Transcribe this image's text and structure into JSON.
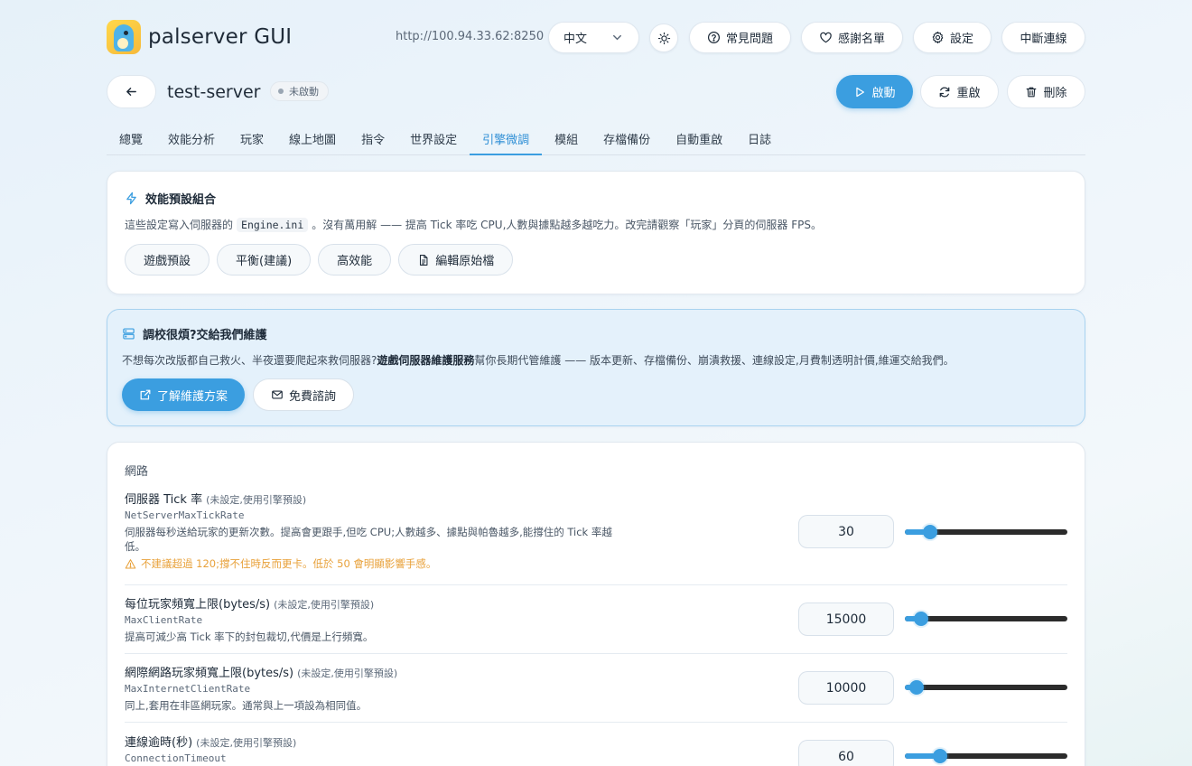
{
  "header": {
    "brand": "palserver GUI",
    "url": "http://100.94.33.62:8250",
    "language": "中文",
    "faq": "常見問題",
    "thanks": "感謝名單",
    "settings": "設定",
    "disconnect": "中斷連線"
  },
  "server": {
    "name": "test-server",
    "status": "未啟動",
    "start": "啟動",
    "restart": "重啟",
    "delete": "刪除"
  },
  "tabs": [
    "總覽",
    "效能分析",
    "玩家",
    "線上地圖",
    "指令",
    "世界設定",
    "引擎微調",
    "模組",
    "存檔備份",
    "自動重啟",
    "日誌"
  ],
  "active_tab": "引擎微調",
  "preset": {
    "title": "效能預設組合",
    "desc_before": "這些設定寫入伺服器的",
    "desc_code": "Engine.ini",
    "desc_after": "。沒有萬用解 —— 提高 Tick 率吃 CPU,人數與據點越多越吃力。改完請觀察「玩家」分頁的伺服器 FPS。",
    "buttons": [
      "遊戲預設",
      "平衡(建議)",
      "高效能"
    ],
    "edit_raw": "編輯原始檔"
  },
  "promo": {
    "title": "調校很煩?交給我們維護",
    "desc_before": "不想每次改版都自己救火、半夜還要爬起來救伺服器?",
    "desc_bold": "遊戲伺服器維護服務",
    "desc_after": "幫你長期代管維護 —— 版本更新、存檔備份、崩潰救援、連線設定,月費制透明計價,維運交給我們。",
    "primary": "了解維護方案",
    "secondary": "免費諮詢"
  },
  "network": {
    "section": "網路",
    "rows": [
      {
        "title": "伺服器 Tick 率",
        "hint": "(未設定,使用引擎預設)",
        "key": "NetServerMaxTickRate",
        "desc": "伺服器每秒送給玩家的更新次數。提高會更跟手,但吃 CPU;人數越多、據點與帕魯越多,能撐住的 Tick 率越低。",
        "warn": "不建議超過 120;撐不住時反而更卡。低於 50 會明顯影響手感。",
        "value": "30",
        "slider_fraction": 0.12
      },
      {
        "title": "每位玩家頻寬上限(bytes/s)",
        "hint": "(未設定,使用引擎預設)",
        "key": "MaxClientRate",
        "desc": "提高可減少高 Tick 率下的封包裁切,代價是上行頻寬。",
        "value": "15000",
        "slider_fraction": 0.06
      },
      {
        "title": "網際網路玩家頻寬上限(bytes/s)",
        "hint": "(未設定,使用引擎預設)",
        "key": "MaxInternetClientRate",
        "desc": "同上,套用在非區網玩家。通常與上一項設為相同值。",
        "value": "10000",
        "slider_fraction": 0.03
      },
      {
        "title": "連線逾時(秒)",
        "hint": "(未設定,使用引擎預設)",
        "key": "ConnectionTimeout",
        "desc": "",
        "value": "60",
        "slider_fraction": 0.19
      }
    ]
  }
}
